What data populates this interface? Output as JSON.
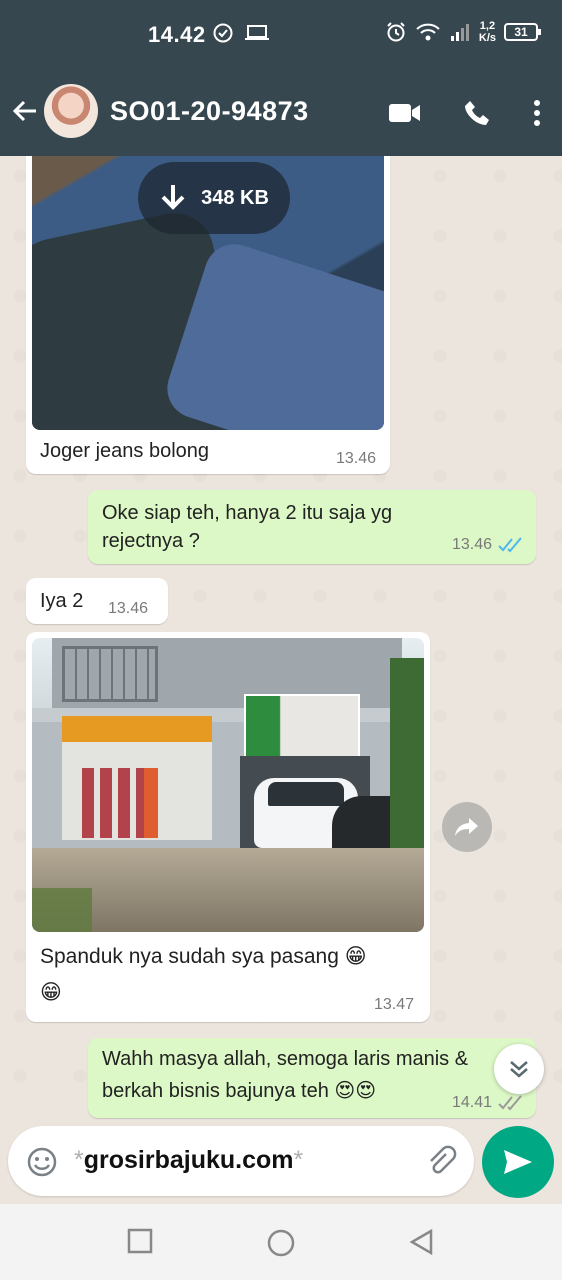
{
  "status": {
    "time": "14.42",
    "net_speed_top": "1,2",
    "net_speed_bottom": "K/s",
    "battery": "31"
  },
  "header": {
    "contact_name": "SO01-20-94873",
    "icons": [
      "back-arrow-icon",
      "video-call-icon",
      "phone-icon",
      "more-vert-icon"
    ]
  },
  "messages": [
    {
      "type": "image",
      "direction": "in",
      "download_size": "348 KB",
      "caption": "Joger jeans bolong",
      "time": "13.46"
    },
    {
      "type": "text",
      "direction": "out",
      "text_line1": "Oke siap teh, hanya 2 itu saja yg",
      "text_line2": "rejectnya ?",
      "time": "13.46",
      "status": "read"
    },
    {
      "type": "text",
      "direction": "in",
      "text": "Iya 2",
      "time": "13.46"
    },
    {
      "type": "image",
      "direction": "in",
      "caption_line1": "Spanduk nya sudah sya pasang 😁",
      "caption_line2": "😁",
      "time": "13.47"
    },
    {
      "type": "text",
      "direction": "out",
      "text_line1": "Wahh masya allah, semoga laris manis &",
      "text_line2": "berkah bisnis bajunya teh 😍😍",
      "time": "14.41",
      "status": "delivered"
    }
  ],
  "composer": {
    "text_prefix": "*",
    "text": "grosirbajuku.com",
    "text_suffix": "*"
  },
  "colors": {
    "header": "#37474f",
    "outgoing_bubble": "#dcf8c6",
    "incoming_bubble": "#ffffff",
    "send_button": "#00a884",
    "read_ticks": "#4fb6ec"
  }
}
